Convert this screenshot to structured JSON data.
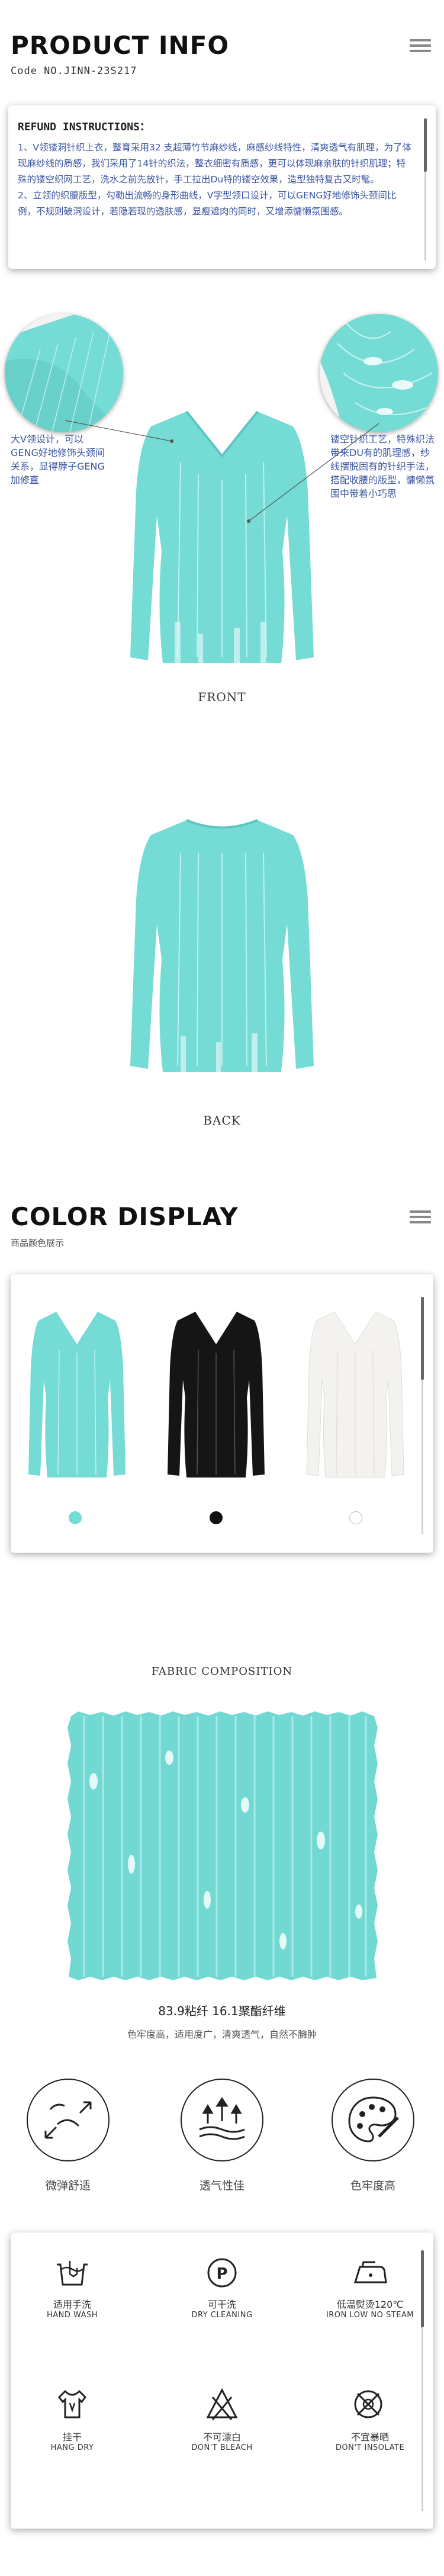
{
  "product_info": {
    "title": "PRODUCT INFO",
    "code": "Code NO.JINN-23S217"
  },
  "refund": {
    "heading": "REFUND INSTRUCTIONS：",
    "body": "1、V领镂洞针织上衣，整育采用32 支超薄竹节麻纱线，麻感纱线特性，清爽透气有肌理，为了体现麻纱线的质感，我们采用了14针的织法，整衣细密有质感，更可以体现麻亲肤的针织肌理；特殊的镂空织网工艺，洗水之前先放针，手工拉出Du特的镂空效果，造型独特复古又时髦。\n2、立领的织腰版型，勾勒出流畅的身形曲线，V字型领口设计，可以GENG好地修饰头颈间比例，不规则破洞设计，若隐若现的透肤感，显瘦遮肉的同时，又增添慵懒氛围感。"
  },
  "callouts": {
    "left": "大V领设计，可以GENG好地修饰头颈间关系，显得脖子GENG加修直",
    "right": "镂空针织工艺，特殊织法带来DU有的肌理感，纱线摆脱固有的针织手法，搭配收腰的版型，慵懒氛围中带着小巧思"
  },
  "captions": {
    "front": "FRONT",
    "back": "BACK"
  },
  "color_display": {
    "title": "COLOR DISPLAY",
    "subtitle": "商品颜色展示",
    "colors": [
      {
        "name": "teal",
        "hex": "#74dbd5"
      },
      {
        "name": "black",
        "hex": "#111111"
      },
      {
        "name": "white",
        "hex": "#f4f2ee"
      }
    ]
  },
  "fabric": {
    "heading": "FABRIC COMPOSITION",
    "composition": "83.9粘纤 16.1聚酯纤维",
    "note": "色牢度高，适用度广，清爽透气，自然不臃肿"
  },
  "features": [
    {
      "label": "微弹舒适",
      "icon": "stretch-icon"
    },
    {
      "label": "透气性佳",
      "icon": "breathable-icon"
    },
    {
      "label": "色牢度高",
      "icon": "palette-icon"
    }
  ],
  "care": [
    {
      "cn": "适用手洗",
      "en": "HAND WASH",
      "icon": "hand-wash-icon"
    },
    {
      "cn": "可干洗",
      "en": "DRY CLEANING",
      "icon": "dry-clean-icon"
    },
    {
      "cn": "低温熨烫120℃",
      "en": "IRON LOW NO STEAM",
      "icon": "iron-icon"
    },
    {
      "cn": "挂干",
      "en": "HANG DRY",
      "icon": "hang-dry-icon"
    },
    {
      "cn": "不可漂白",
      "en": "DON'T BLEACH",
      "icon": "no-bleach-icon"
    },
    {
      "cn": "不宜暴晒",
      "en": "DON'T INSOLATE",
      "icon": "no-sun-icon"
    }
  ]
}
